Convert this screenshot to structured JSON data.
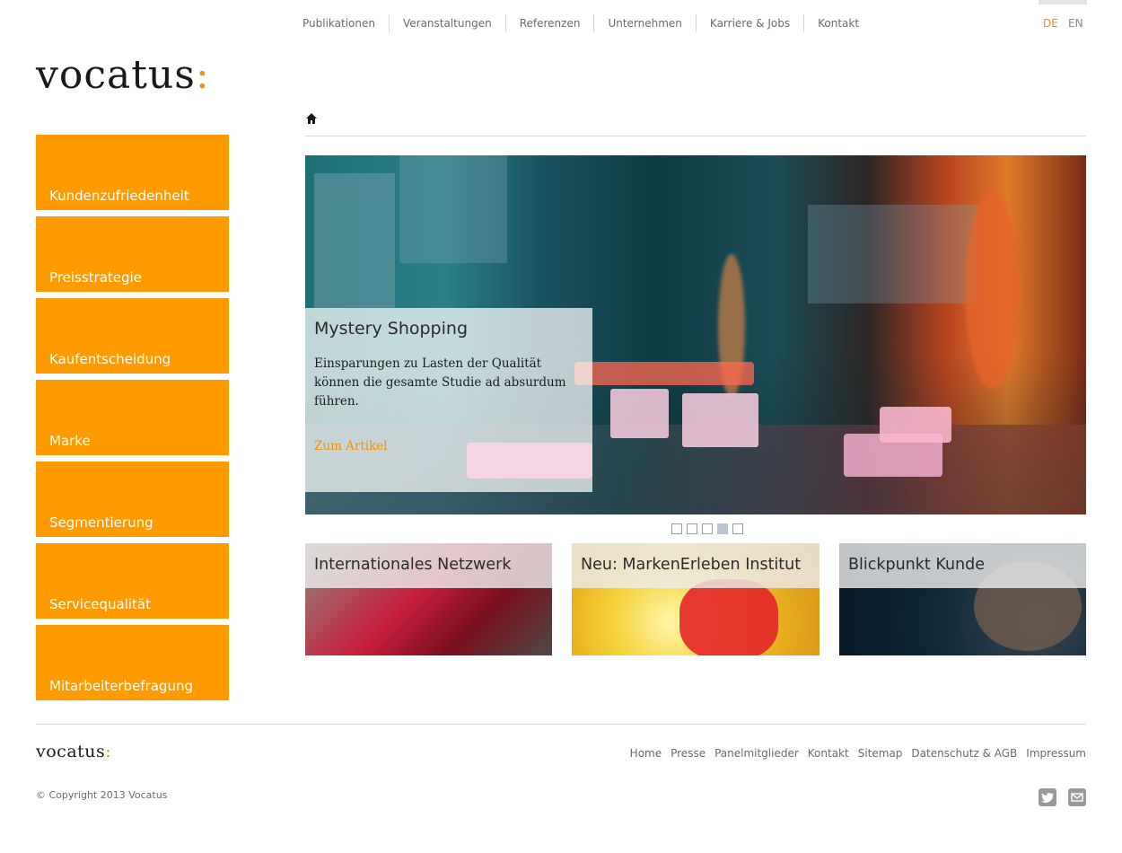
{
  "top_nav": [
    "Publikationen",
    "Veranstaltungen",
    "Referenzen",
    "Unternehmen",
    "Karriere & Jobs",
    "Kontakt"
  ],
  "lang": {
    "de": "DE",
    "en": "EN",
    "active": "DE",
    "active_color": "#f39200"
  },
  "logo": {
    "text": "vocatus",
    "accent": ":"
  },
  "sidebar": [
    "Kundenzufriedenheit",
    "Preisstrategie",
    "Kaufentscheidung",
    "Marke",
    "Segmentierung",
    "Servicequalität",
    "Mitarbeiterbefragung"
  ],
  "breadcrumb": {
    "icon": "home-icon"
  },
  "hero": {
    "title": "Mystery Shopping",
    "text": "Einsparungen zu Lasten der Qualität können die gesamte Studie ad absurdum führen.",
    "link": "Zum Artikel",
    "slides_total": 5,
    "active_slide": 4
  },
  "teasers": [
    "Internationales Netzwerk",
    "Neu: MarkenErleben Institut",
    "Blickpunkt Kunde"
  ],
  "footer": {
    "logo_text": "vocatus",
    "logo_accent": ":",
    "links": [
      "Home",
      "Presse",
      "Panelmitglieder",
      "Kontakt",
      "Sitemap",
      "Datenschutz & AGB",
      "Impressum"
    ],
    "copyright": "© Copyright 2013 Vocatus",
    "social": [
      "twitter-icon",
      "mail-icon"
    ]
  },
  "colors": {
    "accent": "#ff9a00",
    "text": "#444444",
    "nav": "#6b6b6b"
  }
}
